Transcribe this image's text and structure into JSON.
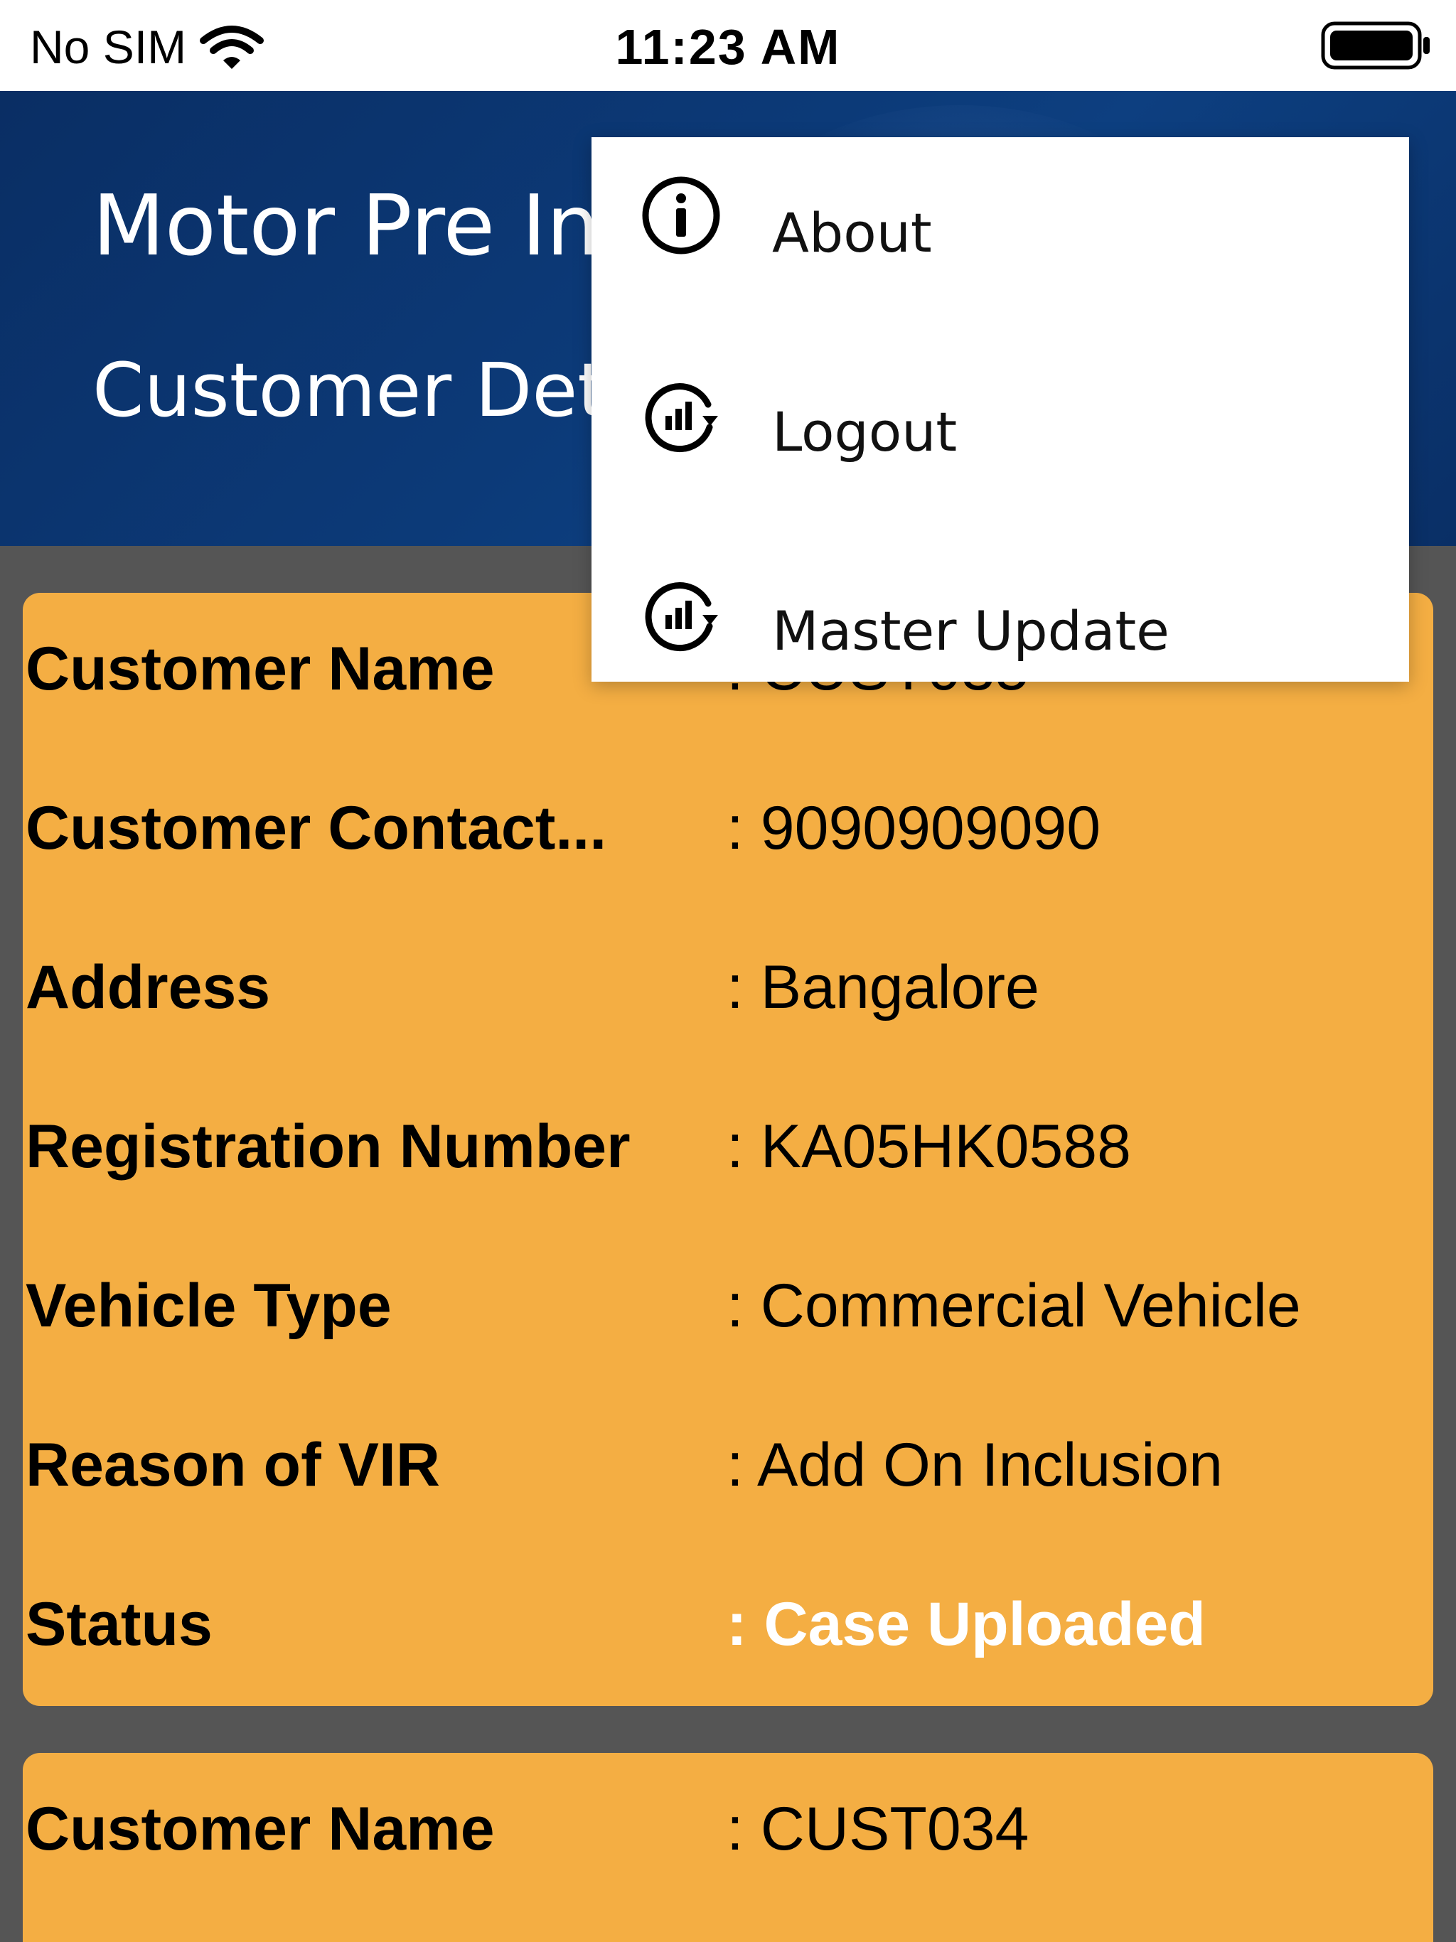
{
  "status_bar": {
    "carrier": "No SIM",
    "time": "11:23 AM"
  },
  "header": {
    "title": "Motor Pre Inspection",
    "subtitle": "Customer Details"
  },
  "menu": {
    "items": [
      {
        "label": "About",
        "icon": "info-icon"
      },
      {
        "label": "Logout",
        "icon": "refresh-chart-icon"
      },
      {
        "label": "Master Update",
        "icon": "refresh-chart-icon"
      }
    ]
  },
  "cards": [
    {
      "rows": [
        {
          "label": "Customer Name",
          "value": ": CUST035"
        },
        {
          "label": "Customer Contact...",
          "value": ": 9090909090"
        },
        {
          "label": "Address",
          "value": ": Bangalore"
        },
        {
          "label": "Registration Number",
          "value": ": KA05HK0588"
        },
        {
          "label": "Vehicle Type",
          "value": ": Commercial Vehicle"
        },
        {
          "label": "Reason of VIR",
          "value": ": Add On Inclusion"
        },
        {
          "label": "Status",
          "value": ": Case Uploaded"
        }
      ]
    },
    {
      "rows": [
        {
          "label": "Customer Name",
          "value": ": CUST034"
        }
      ]
    }
  ],
  "colors": {
    "card_background": "#f4ae43",
    "header_background": "#0c3a78",
    "overlay_background": "#555555",
    "status_value": "#ffffff"
  }
}
